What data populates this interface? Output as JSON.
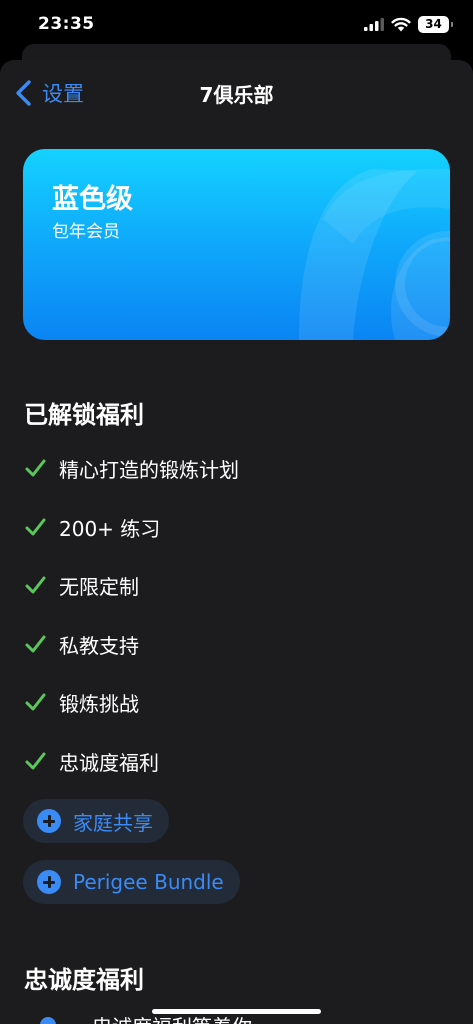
{
  "status_bar": {
    "time": "23:35",
    "battery": "34"
  },
  "nav": {
    "back_label": "设置",
    "title": "7俱乐部"
  },
  "card": {
    "tier": "蓝色级",
    "type": "包年会员"
  },
  "unlocked": {
    "title": "已解锁福利",
    "items": [
      "精心打造的锻炼计划",
      "200+ 练习",
      "无限定制",
      "私教支持",
      "锻炼挑战",
      "忠诚度福利"
    ]
  },
  "addons": [
    "家庭共享",
    "Perigee Bundle"
  ],
  "loyalty": {
    "title": "忠诚度福利",
    "first_item": "忠诚度福利等着你"
  },
  "colors": {
    "accent": "#3a8bf5",
    "check": "#5ac85a",
    "card_top": "#14d2ff",
    "card_bottom": "#0a84f3",
    "sheet": "#1c1c1e"
  }
}
